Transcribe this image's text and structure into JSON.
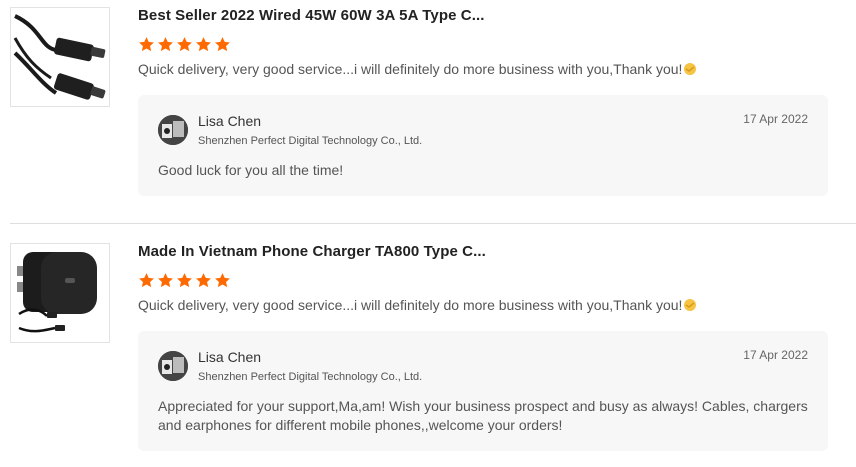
{
  "reviews": [
    {
      "product_title": "Best Seller 2022 Wired 45W 60W 3A 5A Type C...",
      "product_image": "usb-c-cable",
      "rating": 5,
      "comment": "Quick delivery, very good service...i will definitely do more business with you,Thank you!",
      "comment_emoji": "handshake-emoji",
      "reply": {
        "name": "Lisa Chen",
        "company": "Shenzhen Perfect Digital Technology Co., Ltd.",
        "date": "17 Apr 2022",
        "text": "Good luck for you all the time!"
      }
    },
    {
      "product_title": "Made In Vietnam Phone Charger TA800 Type C...",
      "product_image": "wall-charger-with-cable",
      "rating": 5,
      "comment": "Quick delivery, very good service...i will definitely do more business with you,Thank you!",
      "comment_emoji": "handshake-emoji",
      "reply": {
        "name": "Lisa Chen",
        "company": "Shenzhen Perfect Digital Technology Co., Ltd.",
        "date": "17 Apr 2022",
        "text": "Appreciated for your support,Ma,am! Wish your business prospect and busy as always! Cables, chargers and earphones for different mobile phones,,welcome your orders!"
      }
    }
  ],
  "colors": {
    "star": "#ff6a00",
    "reply_bg": "#f7f7f8",
    "divider": "#dedede"
  }
}
